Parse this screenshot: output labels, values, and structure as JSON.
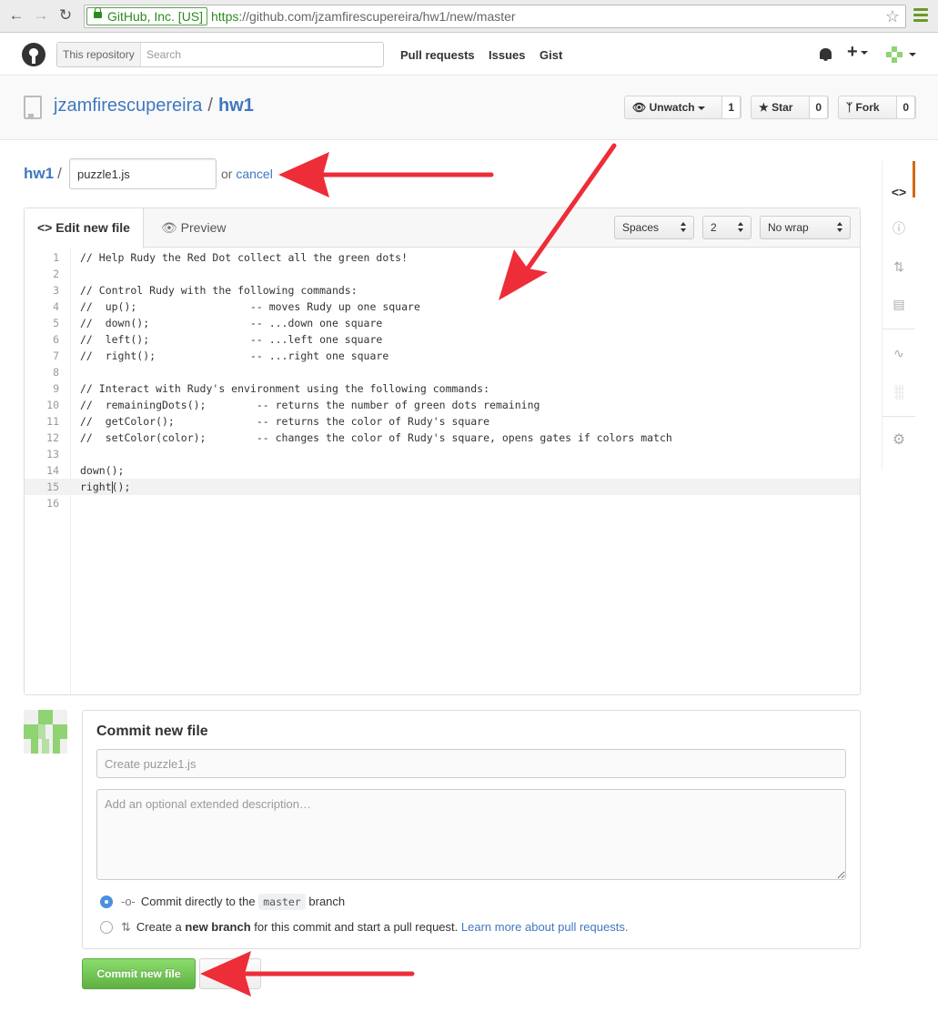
{
  "browser": {
    "ev_label": "GitHub, Inc. [US]",
    "url_scheme": "https",
    "url_rest": "://github.com/jzamfirescupereira/hw1/new/master"
  },
  "header": {
    "search_scope": "This repository",
    "search_placeholder": "Search",
    "nav": [
      "Pull requests",
      "Issues",
      "Gist"
    ]
  },
  "repo": {
    "owner": "jzamfirescupereira",
    "separator": "/",
    "name": "hw1",
    "unwatch_label": "Unwatch",
    "unwatch_count": "1",
    "star_label": "Star",
    "star_count": "0",
    "fork_label": "Fork",
    "fork_count": "0"
  },
  "breadcrumb": {
    "root": "hw1",
    "slash": "/",
    "filename": "puzzle1.js",
    "or_text": "or",
    "cancel": "cancel"
  },
  "editor": {
    "tab_edit": "Edit new file",
    "tab_preview": "Preview",
    "indent_mode": "Spaces",
    "indent_size": "2",
    "wrap_mode": "No wrap",
    "lines": [
      "// Help Rudy the Red Dot collect all the green dots!",
      "",
      "// Control Rudy with the following commands:",
      "//  up();                  -- moves Rudy up one square",
      "//  down();                -- ...down one square",
      "//  left();                -- ...left one square",
      "//  right();               -- ...right one square",
      "",
      "// Interact with Rudy's environment using the following commands:",
      "//  remainingDots();        -- returns the number of green dots remaining",
      "//  getColor();             -- returns the color of Rudy's square",
      "//  setColor(color);        -- changes the color of Rudy's square, opens gates if colors match",
      "",
      "down();",
      "right();",
      ""
    ],
    "highlighted_line": 15
  },
  "commit": {
    "title": "Commit new file",
    "summary_placeholder": "Create puzzle1.js",
    "description_placeholder": "Add an optional extended description…",
    "option1_prefix": "Commit directly to the",
    "option1_branch": "master",
    "option1_suffix": "branch",
    "option2_prefix": "Create a",
    "option2_bold": "new branch",
    "option2_suffix": "for this commit and start a pull request.",
    "option2_link": "Learn more about pull requests.",
    "submit_label": "Commit new file"
  },
  "colors": {
    "link_blue": "#4078c0",
    "commit_green": "#60b044",
    "annotation_red": "#ed2d38"
  }
}
